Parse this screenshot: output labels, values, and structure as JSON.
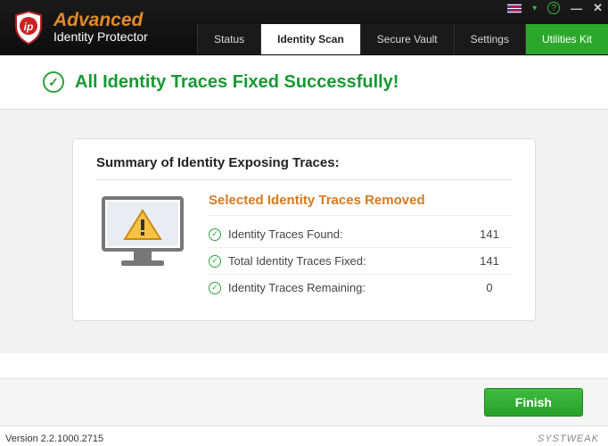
{
  "header": {
    "app_name": "Advanced",
    "app_sub": "Identity Protector",
    "tabs": {
      "status": "Status",
      "scan": "Identity Scan",
      "vault": "Secure Vault",
      "settings": "Settings",
      "util": "Utilities Kit"
    }
  },
  "banner": {
    "message": "All Identity Traces Fixed Successfully!"
  },
  "card": {
    "title": "Summary of Identity Exposing Traces:",
    "removed_title": "Selected Identity Traces Removed",
    "rows": {
      "found_label": "Identity Traces Found:",
      "found_value": "141",
      "fixed_label": "Total Identity Traces Fixed:",
      "fixed_value": "141",
      "remain_label": "Identity Traces Remaining:",
      "remain_value": "0"
    }
  },
  "bottom": {
    "finish": "Finish"
  },
  "footer": {
    "version": "Version 2.2.1000.2715",
    "watermark": "SYSTWEAK"
  }
}
